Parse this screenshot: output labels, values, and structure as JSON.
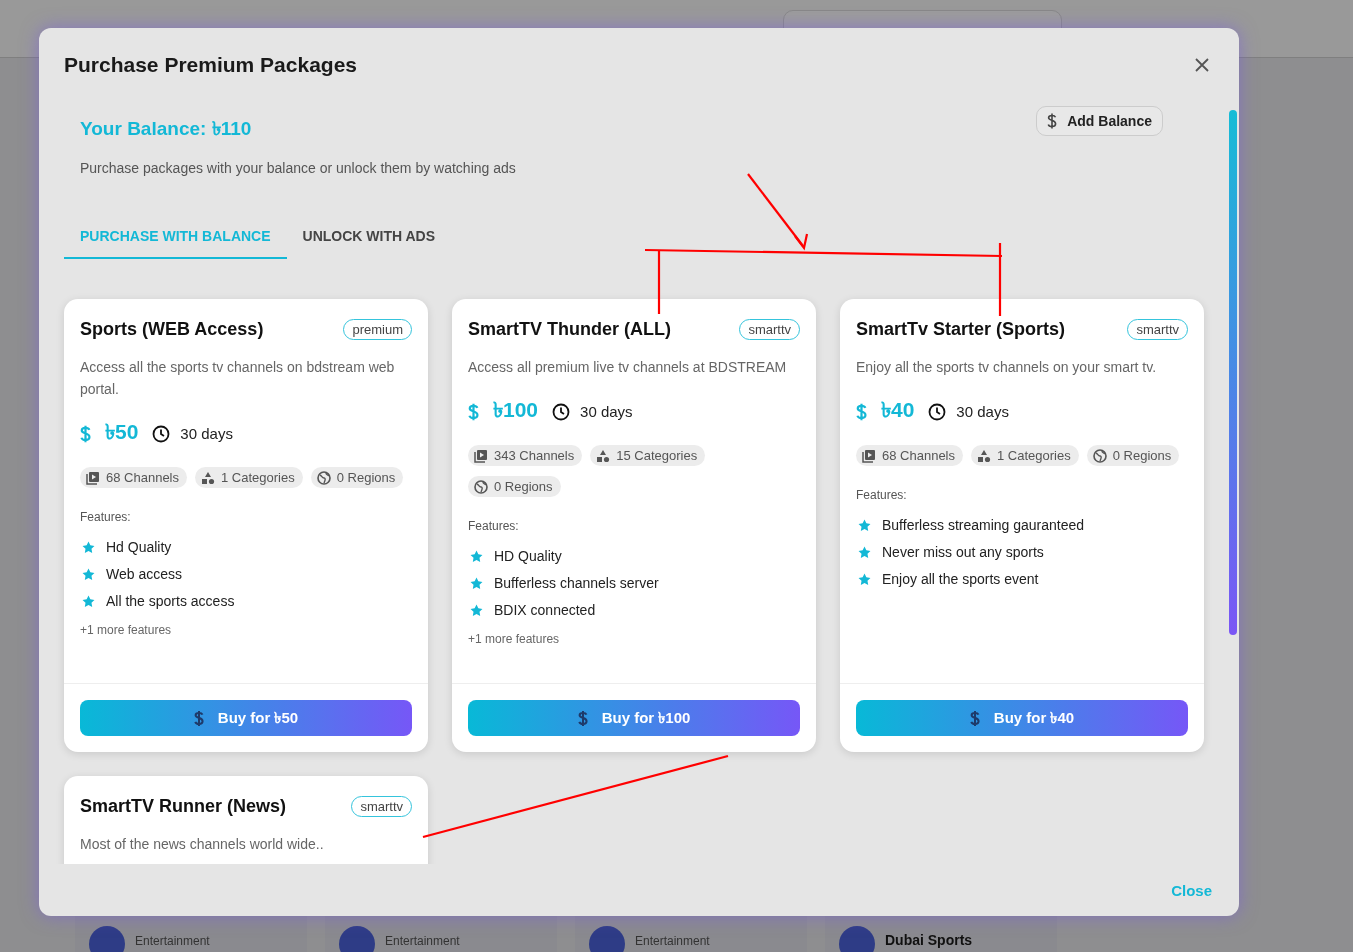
{
  "background_page": {
    "channel_cards": [
      {
        "kind": "category",
        "text": "Entertainment"
      },
      {
        "kind": "category",
        "text": "Entertainment"
      },
      {
        "kind": "category",
        "text": "Entertainment"
      },
      {
        "kind": "name",
        "text": "Dubai Sports"
      }
    ]
  },
  "modal": {
    "title": "Purchase Premium Packages",
    "balance": "Your Balance: ৳110",
    "add_balance": "Add Balance",
    "subtitle": "Purchase packages with your balance or unlock them by watching ads",
    "tabs": [
      {
        "label": "PURCHASE WITH BALANCE",
        "selected": true
      },
      {
        "label": "UNLOCK WITH ADS",
        "selected": false
      }
    ],
    "packages": [
      {
        "name": "Sports (WEB Access)",
        "badge": "premium",
        "description": "Access all the sports tv channels on bdstream web portal.",
        "price": "৳50",
        "duration": "30 days",
        "channels": "68 Channels",
        "categories": "1 Categories",
        "regions": "0 Regions",
        "features_label": "Features:",
        "features": [
          "Hd Quality",
          "Web access",
          "All the sports access"
        ],
        "more": "+1 more features",
        "buy": "Buy for ৳50"
      },
      {
        "name": "SmartTV Thunder (ALL)",
        "badge": "smarttv",
        "description": "Access all premium live tv channels at BDSTREAM",
        "price": "৳100",
        "duration": "30 days",
        "channels": "343 Channels",
        "categories": "15 Categories",
        "regions": "0 Regions",
        "features_label": "Features:",
        "features": [
          "HD Quality",
          "Bufferless channels server",
          "BDIX connected"
        ],
        "more": "+1 more features",
        "buy": "Buy for ৳100"
      },
      {
        "name": "SmartTv Starter (Sports)",
        "badge": "smarttv",
        "description": "Enjoy all the sports tv channels on your smart tv.",
        "price": "৳40",
        "duration": "30 days",
        "channels": "68 Channels",
        "categories": "1 Categories",
        "regions": "0 Regions",
        "features_label": "Features:",
        "features": [
          "Bufferless streaming gauranteed",
          "Never miss out any sports",
          "Enjoy all the sports event"
        ],
        "buy": "Buy for ৳40"
      },
      {
        "name": "SmartTV Runner (News)",
        "badge": "smarttv",
        "description": "Most of the news channels world wide.."
      }
    ],
    "close": "Close"
  }
}
